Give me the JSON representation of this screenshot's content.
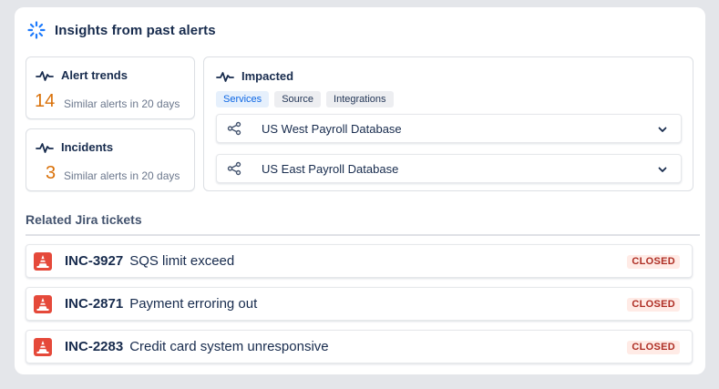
{
  "header": {
    "title": "Insights from past alerts",
    "icon": "opsgenie-burst-icon"
  },
  "alert_trends": {
    "title": "Alert trends",
    "count": "14",
    "subtitle": "Similar alerts in 20 days"
  },
  "incidents": {
    "title": "Incidents",
    "count": "3",
    "subtitle": "Similar alerts in 20 days"
  },
  "impacted": {
    "title": "Impacted",
    "tabs": [
      {
        "label": "Services",
        "active": true
      },
      {
        "label": "Source",
        "active": false
      },
      {
        "label": "Integrations",
        "active": false
      }
    ],
    "services": [
      {
        "name": "US West Payroll Database",
        "icon": "service-graph-icon"
      },
      {
        "name": "US East Payroll Database",
        "icon": "service-graph-icon"
      }
    ]
  },
  "related": {
    "title": "Related Jira tickets",
    "tickets": [
      {
        "key": "INC-3927",
        "summary": "SQS limit exceed",
        "status": "CLOSED"
      },
      {
        "key": "INC-2871",
        "summary": "Payment erroring out",
        "status": "CLOSED"
      },
      {
        "key": "INC-2283",
        "summary": "Credit card system unresponsive",
        "status": "CLOSED"
      }
    ]
  },
  "colors": {
    "accent_number": "#d97008",
    "status_closed_bg": "#ffebe6",
    "status_closed_text": "#ae2e24",
    "ticket_icon": "#e5493a",
    "header_icon": "#1d7afc"
  }
}
